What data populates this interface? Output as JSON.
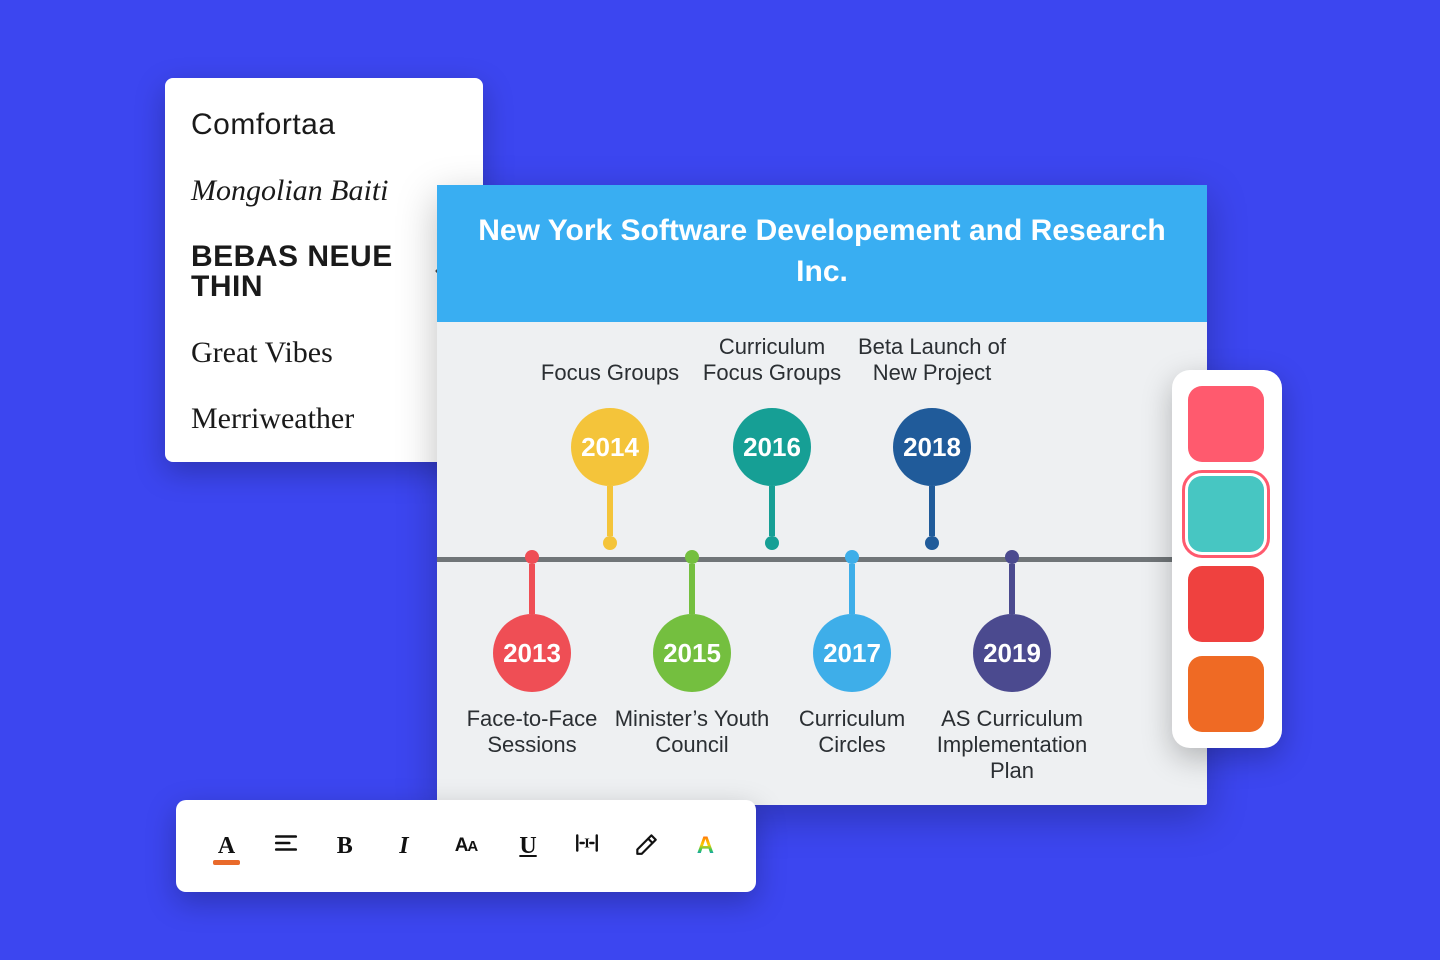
{
  "font_panel": {
    "items": [
      {
        "name": "Comfortaa",
        "css": "font-comfortaa",
        "selected": false
      },
      {
        "name": "Mongolian Baiti",
        "css": "font-mongolian",
        "selected": false
      },
      {
        "name": "BEBAS NEUE THIN",
        "css": "font-bebas",
        "selected": true
      },
      {
        "name": "Great Vibes",
        "css": "font-greatvibes",
        "selected": false
      },
      {
        "name": "Merriweather",
        "css": "font-merri",
        "selected": false
      }
    ]
  },
  "canvas": {
    "title": "New York Software Developement and Research Inc.",
    "events": [
      {
        "year": "2013",
        "label": "Face-to-Face Sessions",
        "side": "down",
        "color": "#ef4e55"
      },
      {
        "year": "2014",
        "label": "Focus Groups",
        "side": "up",
        "color": "#f4c43a"
      },
      {
        "year": "2015",
        "label": "Minister’s Youth Council",
        "side": "down",
        "color": "#74bf3f"
      },
      {
        "year": "2016",
        "label": "Curriculum Focus Groups",
        "side": "up",
        "color": "#169f95"
      },
      {
        "year": "2017",
        "label": "Curriculum Circles",
        "side": "down",
        "color": "#3eaee9"
      },
      {
        "year": "2018",
        "label": "Beta Launch of New Project",
        "side": "up",
        "color": "#205b9a"
      },
      {
        "year": "2019",
        "label": "AS Curriculum Implementation Plan",
        "side": "down",
        "color": "#4b4a8f"
      }
    ]
  },
  "palette": {
    "swatches": [
      {
        "color": "#ff5a6e",
        "selected": false
      },
      {
        "color": "#47c6c2",
        "selected": true
      },
      {
        "color": "#ef413f",
        "selected": false
      },
      {
        "color": "#ef6a24",
        "selected": false
      }
    ]
  },
  "toolbar": {
    "font_color": "A",
    "align": "≡",
    "bold": "B",
    "italic": "I",
    "case": "AA",
    "underline": "U",
    "spacing": "↔",
    "highlight": "⬚",
    "text_color": "A"
  }
}
